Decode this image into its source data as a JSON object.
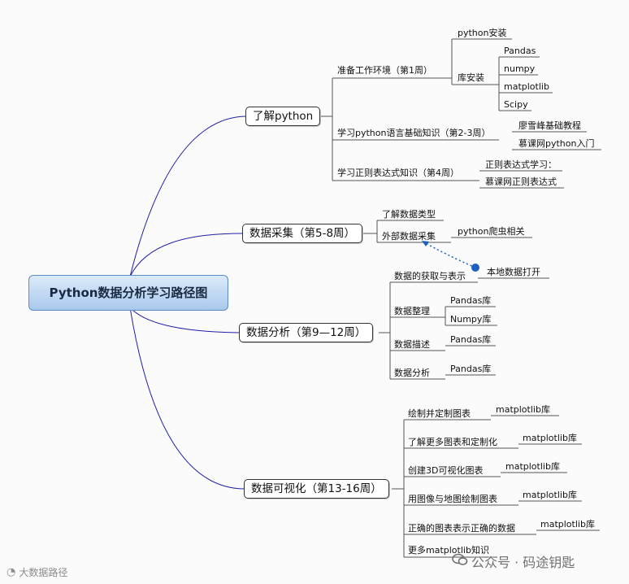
{
  "root": {
    "label": "Python数据分析学习路径图"
  },
  "main_nodes": [
    {
      "label": "了解python"
    },
    {
      "label": "数据采集（第5-8周）"
    },
    {
      "label": "数据分析（第9—12周）"
    },
    {
      "label": "数据可视化（第13-16周）"
    }
  ],
  "python": {
    "env": "准备工作环境（第1周）",
    "install": "python安装",
    "libs": "库安装",
    "pandas": "Pandas",
    "numpy": "numpy",
    "matplotlib": "matplotlib",
    "scipy": "Scipy",
    "basics": "学习python语言基础知识（第2-3周）",
    "liao": "廖雪峰基础教程",
    "mooc_intro": "慕课网python入门",
    "regex": "学习正则表达式知识（第4周）",
    "regex_study": "正则表达式学习：",
    "mooc_regex": "慕课网正则表达式"
  },
  "collect": {
    "types": "了解数据类型",
    "external": "外部数据采集",
    "crawler": "python爬虫相关"
  },
  "analysis": {
    "acquire": "数据的获取与表示",
    "local_open": "本地数据打开",
    "tidy": "数据整理",
    "pandas_lib": "Pandas库",
    "numpy_lib": "Numpy库",
    "describe": "数据描述",
    "describe_lib": "Pandas库",
    "analyze": "数据分析",
    "analyze_lib": "Pandas库"
  },
  "viz": {
    "items": [
      {
        "label": "绘制并定制图表",
        "lib": "matplotlib库"
      },
      {
        "label": "了解更多图表和定制化",
        "lib": "matplotlib库"
      },
      {
        "label": "创建3D可视化图表",
        "lib": "matplotlib库"
      },
      {
        "label": "用图像与地图绘制图表",
        "lib": "matplotlib库"
      },
      {
        "label": "正确的图表表示正确的数据",
        "lib": "matplotlib库"
      },
      {
        "label": "更多matplotlib知识",
        "lib": ""
      }
    ]
  },
  "watermarks": {
    "left": "大数据路径",
    "right": "公众号 · 码途钥匙"
  },
  "colors": {
    "branch": "#1f1fa8",
    "line": "#555555",
    "dotted": "#1c5fc0",
    "root_border": "#5a8cc6"
  },
  "icons": {
    "left_watermark": "logo-mark-icon",
    "right_watermark": "wechat-icon"
  }
}
